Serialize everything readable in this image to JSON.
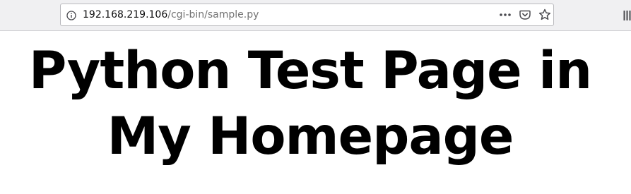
{
  "browser": {
    "address_bar": {
      "url_host": "192.168.219.106",
      "url_path": "/cgi-bin/sample.py",
      "site_info_icon": "info-circle-icon",
      "page_actions_icon": "ellipsis-icon",
      "pocket_icon": "pocket-icon",
      "bookmark_icon": "star-icon"
    },
    "toolbar": {
      "library_icon": "library-icon"
    }
  },
  "page": {
    "heading": "Python Test Page in My Homepage"
  }
}
